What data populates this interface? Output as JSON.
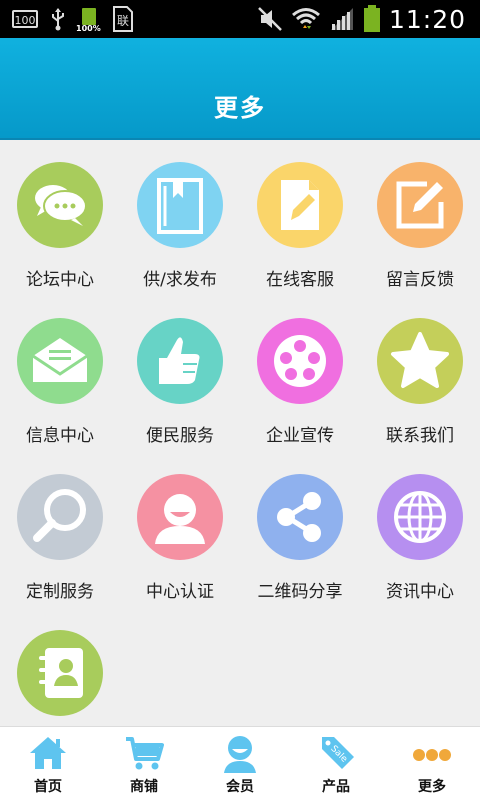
{
  "status_bar": {
    "time": "11:20",
    "box_label": "100",
    "battery_small_label": "100%",
    "sim_label": "联"
  },
  "header": {
    "title": "更多"
  },
  "colors": {
    "header_blue": "#0aa5d6",
    "green": "#a8cc5c",
    "blue_light": "#7fd3f2",
    "yellow": "#fad56a",
    "orange": "#f8b36b",
    "mint": "#8fdc8e",
    "teal": "#67d3c6",
    "pink": "#f06fe0",
    "olive": "#c4cf5a",
    "gray": "#c3cbd4",
    "rose": "#f591a2",
    "periwinkle": "#8fb1ee",
    "purple": "#b68ff0",
    "nav_icon_blue": "#5ec4ef"
  },
  "menu": {
    "items": [
      {
        "label": "论坛中心",
        "icon": "chat-bubbles-icon"
      },
      {
        "label": "供/求发布",
        "icon": "book-icon"
      },
      {
        "label": "在线客服",
        "icon": "document-pencil-icon"
      },
      {
        "label": "留言反馈",
        "icon": "edit-square-icon"
      },
      {
        "label": "信息中心",
        "icon": "envelope-icon"
      },
      {
        "label": "便民服务",
        "icon": "thumbs-up-icon"
      },
      {
        "label": "企业宣传",
        "icon": "film-reel-icon"
      },
      {
        "label": "联系我们",
        "icon": "star-icon"
      },
      {
        "label": "定制服务",
        "icon": "magnifier-icon"
      },
      {
        "label": "中心认证",
        "icon": "user-icon"
      },
      {
        "label": "二维码分享",
        "icon": "share-icon"
      },
      {
        "label": "资讯中心",
        "icon": "globe-icon"
      },
      {
        "label": "",
        "icon": "contact-book-icon"
      }
    ]
  },
  "bottom_nav": {
    "items": [
      {
        "label": "首页",
        "icon": "home-icon"
      },
      {
        "label": "商铺",
        "icon": "cart-icon"
      },
      {
        "label": "会员",
        "icon": "member-icon"
      },
      {
        "label": "产品",
        "icon": "sale-tag-icon",
        "tag_text": "Sale"
      },
      {
        "label": "更多",
        "icon": "more-dots-icon"
      }
    ]
  }
}
